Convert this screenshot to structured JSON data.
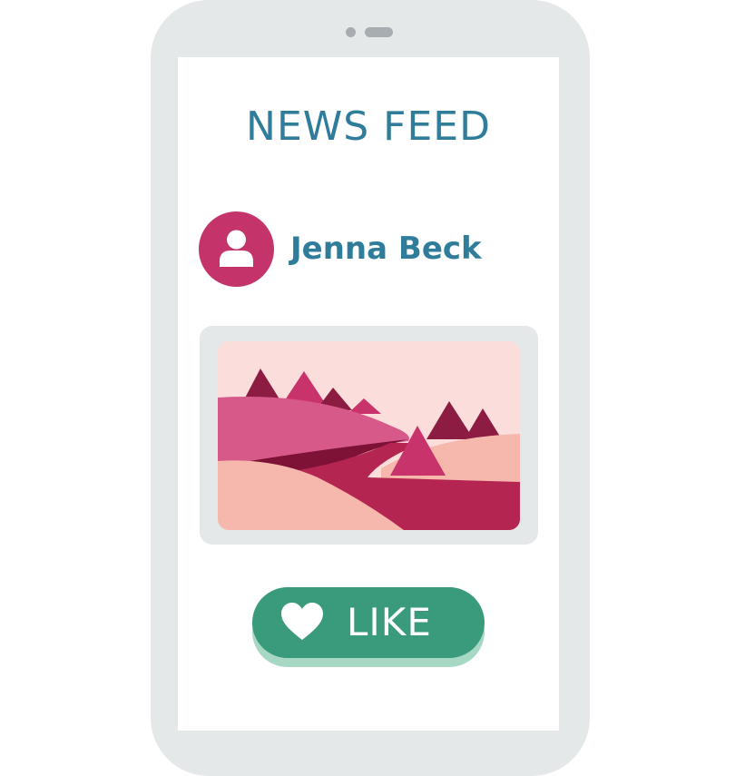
{
  "feed": {
    "title": "NEWS FEED"
  },
  "post": {
    "author_name": "Jenna Beck",
    "avatar_icon": "user-icon",
    "image_icon": "landscape-image"
  },
  "actions": {
    "like_label": "LIKE",
    "like_icon": "heart-icon"
  },
  "colors": {
    "accent_blue": "#2f7d9b",
    "avatar_magenta": "#c4346b",
    "like_green": "#3a9a7c",
    "frame_gray": "#e5e8e8"
  }
}
